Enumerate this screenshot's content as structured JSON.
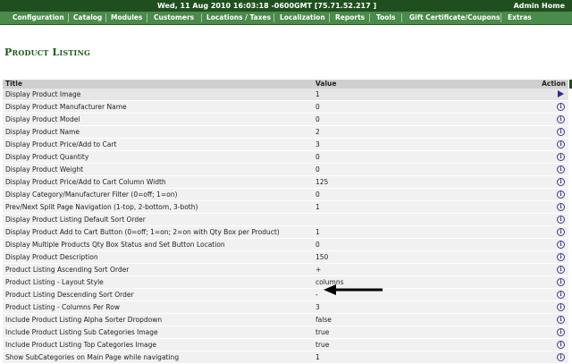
{
  "topbar": {
    "datetime": "Wed, 11 Aug 2010 16:03:18 -0600GMT [75.71.52.217 ]",
    "admin_label": "Admin Home"
  },
  "menu": [
    "Configuration",
    "Catalog",
    "Modules",
    "Customers",
    "Locations / Taxes",
    "Localization",
    "Reports",
    "Tools",
    "Gift Certificate/Coupons",
    "Extras"
  ],
  "page": {
    "title": "Product Listing"
  },
  "table": {
    "headers": {
      "title": "Title",
      "value": "Value",
      "action": "Action"
    },
    "rows": [
      {
        "title": "Display Product Image",
        "value": "1",
        "icon": "play-icon"
      },
      {
        "title": "Display Product Manufacturer Name",
        "value": "0",
        "icon": "info-icon"
      },
      {
        "title": "Display Product Model",
        "value": "0",
        "icon": "info-icon"
      },
      {
        "title": "Display Product Name",
        "value": "2",
        "icon": "info-icon"
      },
      {
        "title": "Display Product Price/Add to Cart",
        "value": "3",
        "icon": "info-icon"
      },
      {
        "title": "Display Product Quantity",
        "value": "0",
        "icon": "info-icon"
      },
      {
        "title": "Display Product Weight",
        "value": "0",
        "icon": "info-icon"
      },
      {
        "title": "Display Product Price/Add to Cart Column Width",
        "value": "125",
        "icon": "info-icon"
      },
      {
        "title": "Display Category/Manufacturer Filter (0=off; 1=on)",
        "value": "0",
        "icon": "info-icon"
      },
      {
        "title": "Prev/Next Split Page Navigation (1-top, 2-bottom, 3-both)",
        "value": "1",
        "icon": "info-icon"
      },
      {
        "title": "Display Product Listing Default Sort Order",
        "value": "",
        "icon": "info-icon"
      },
      {
        "title": "Display Product Add to Cart Button (0=off; 1=on; 2=on with Qty Box per Product)",
        "value": "1",
        "icon": "info-icon"
      },
      {
        "title": "Display Multiple Products Qty Box Status and Set Button Location",
        "value": "0",
        "icon": "info-icon"
      },
      {
        "title": "Display Product Description",
        "value": "150",
        "icon": "info-icon"
      },
      {
        "title": "Product Listing Ascending Sort Order",
        "value": "+",
        "icon": "info-icon"
      },
      {
        "title": "Product Listing - Layout Style",
        "value": "columns",
        "icon": "info-icon"
      },
      {
        "title": "Product Listing Descending Sort Order",
        "value": "-",
        "icon": "info-icon"
      },
      {
        "title": "Product Listing - Columns Per Row",
        "value": "3",
        "icon": "info-icon"
      },
      {
        "title": "Include Product Listing Alpha Sorter Dropdown",
        "value": "false",
        "icon": "info-icon"
      },
      {
        "title": "Include Product Listing Sub Categories Image",
        "value": "true",
        "icon": "info-icon"
      },
      {
        "title": "Include Product Listing Top Categories Image",
        "value": "true",
        "icon": "info-icon"
      },
      {
        "title": "Show SubCategories on Main Page while navigating",
        "value": "1",
        "icon": "info-icon"
      }
    ]
  },
  "colors": {
    "topbar": "#1f4f1f",
    "menubar": "#4a8a4a",
    "title": "#1d5a1d",
    "row_bg": "#f1f1f1",
    "header_bg": "#cfcfcf"
  },
  "annotation": {
    "icon": "left-arrow-annotation"
  }
}
